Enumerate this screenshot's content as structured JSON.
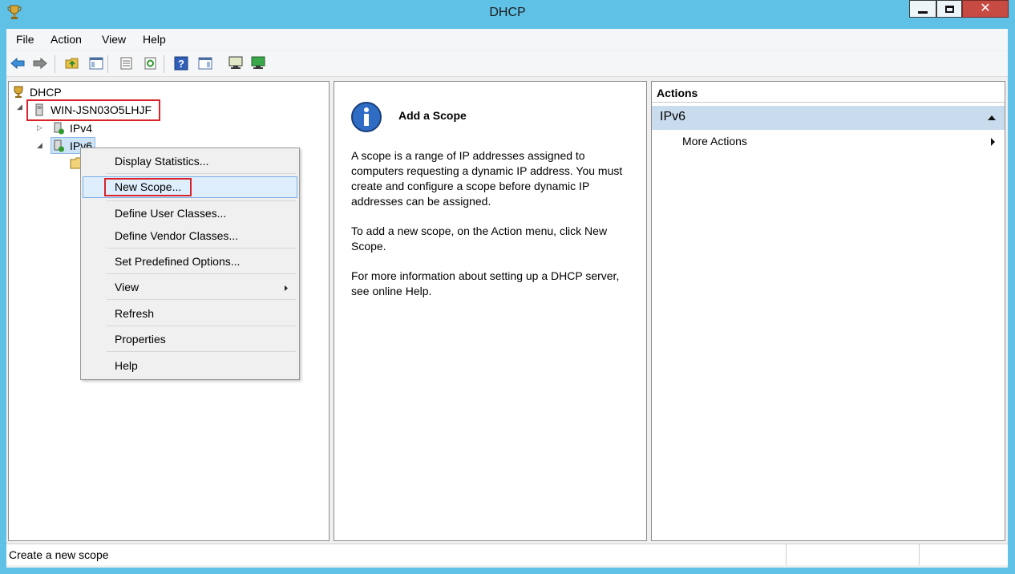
{
  "window": {
    "title": "DHCP",
    "close_glyph": "✕"
  },
  "menu": {
    "items": [
      "File",
      "Action",
      "View",
      "Help"
    ]
  },
  "tree": {
    "root": "DHCP",
    "server": "WIN-JSN03O5LHJF",
    "ipv4": "IPv4",
    "ipv6": "IPv6"
  },
  "context_menu": {
    "items": [
      "Display Statistics...",
      "New Scope...",
      "Define User Classes...",
      "Define Vendor Classes...",
      "Set Predefined Options...",
      "View",
      "Refresh",
      "Properties",
      "Help"
    ]
  },
  "content": {
    "heading": "Add a Scope",
    "para1": "A scope is a range of IP addresses assigned to computers requesting a dynamic IP address. You must create and configure a scope before dynamic IP addresses can be assigned.",
    "para2": "To add a new scope, on the Action menu, click New Scope.",
    "para3": "For more information about setting up a DHCP server, see online Help."
  },
  "actions": {
    "header": "Actions",
    "section": "IPv6",
    "more_actions": "More Actions"
  },
  "status": {
    "text": "Create a new scope"
  },
  "colors": {
    "titlebar": "#5fc1e6",
    "close_button": "#c74a43",
    "highlight_red": "#d9222a",
    "actions_section": "#c9dced"
  }
}
